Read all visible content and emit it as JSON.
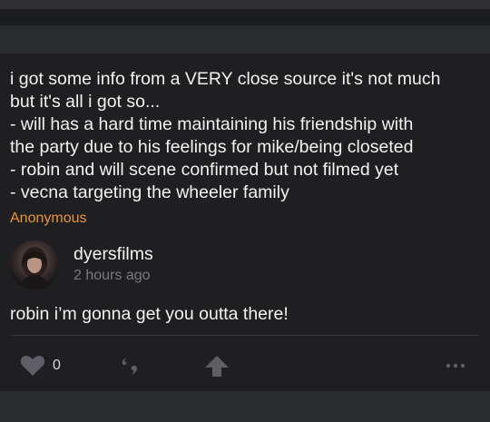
{
  "question": {
    "text": "i got some info from a VERY close source it's not much\nbut it's all i got so...\n- will has a hard time maintaining his friendship with\nthe party due to his feelings for mike/being closeted\n- robin and will scene confirmed but not filmed yet\n- vecna targeting the wheeler family",
    "asker": "Anonymous"
  },
  "answer": {
    "username": "dyersfilms",
    "timestamp": "2 hours ago",
    "text": "robin i’m gonna get you outta there!"
  },
  "actions": {
    "like_count": "0",
    "icons": [
      "heart-icon",
      "quote-icon",
      "upvote-arrow-icon",
      "more-dots-icon"
    ]
  },
  "colors": {
    "accent": "#e8953a",
    "text": "#f2f2f2",
    "muted": "#7a7a7e",
    "icon": "#5e5f64",
    "background": "#1f1f22"
  }
}
